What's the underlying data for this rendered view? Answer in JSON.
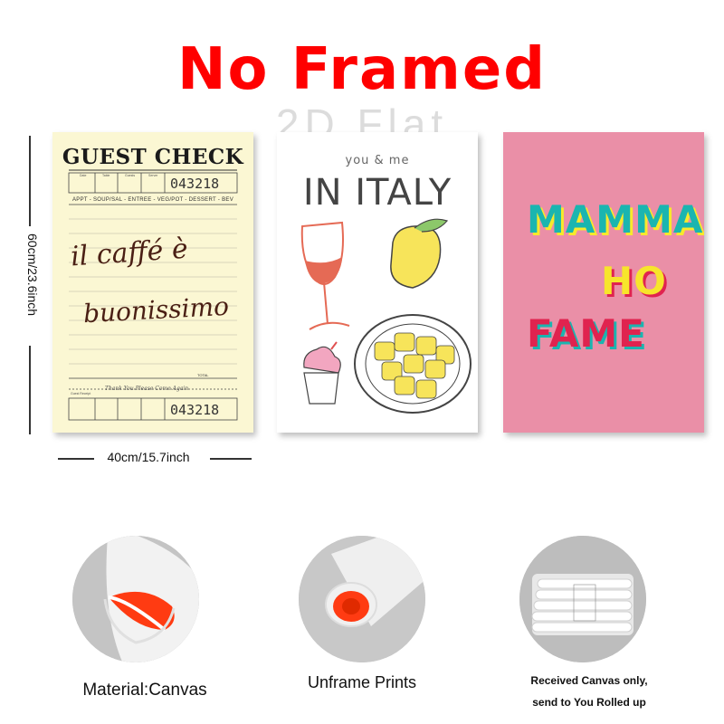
{
  "title": "No Framed",
  "watermark": "2D Flat",
  "dimensions": {
    "height": "60cm/23.6inch",
    "width": "40cm/15.7inch"
  },
  "posters": {
    "guest_check": {
      "title": "GUEST CHECK",
      "number": "043218",
      "categories": "APPT - SOUP/SAL - ENTREE - VEG/POT - DESSERT - BEV",
      "script_line1": "il caffé è",
      "script_line2": "buonissimo",
      "thanks": "Thank You Please Come Again",
      "total": "TOTAL",
      "header_cells": [
        "Date",
        "Table",
        "Guests",
        "Server"
      ],
      "footer_label": "Guest Receipt",
      "background": "#fbf7d3"
    },
    "italy": {
      "small_text": "you & me",
      "big_text": "IN ITALY"
    },
    "mamma": {
      "line1": "MAMMA",
      "line2": "HO",
      "line3": "FAME",
      "background": "#ea8fa7"
    }
  },
  "features": [
    {
      "icon": "canvas-roll-icon",
      "caption": "Material:Canvas"
    },
    {
      "icon": "rolled-print-icon",
      "caption": "Unframe  Prints"
    },
    {
      "icon": "packaged-rolls-icon",
      "caption_line1": "Received Canvas only,",
      "caption_line2": "send to You Rolled up"
    }
  ],
  "colors": {
    "title_red": "#ff0000",
    "teal": "#1ab5b0",
    "yellow": "#f7e52b",
    "crimson": "#e0234f"
  }
}
